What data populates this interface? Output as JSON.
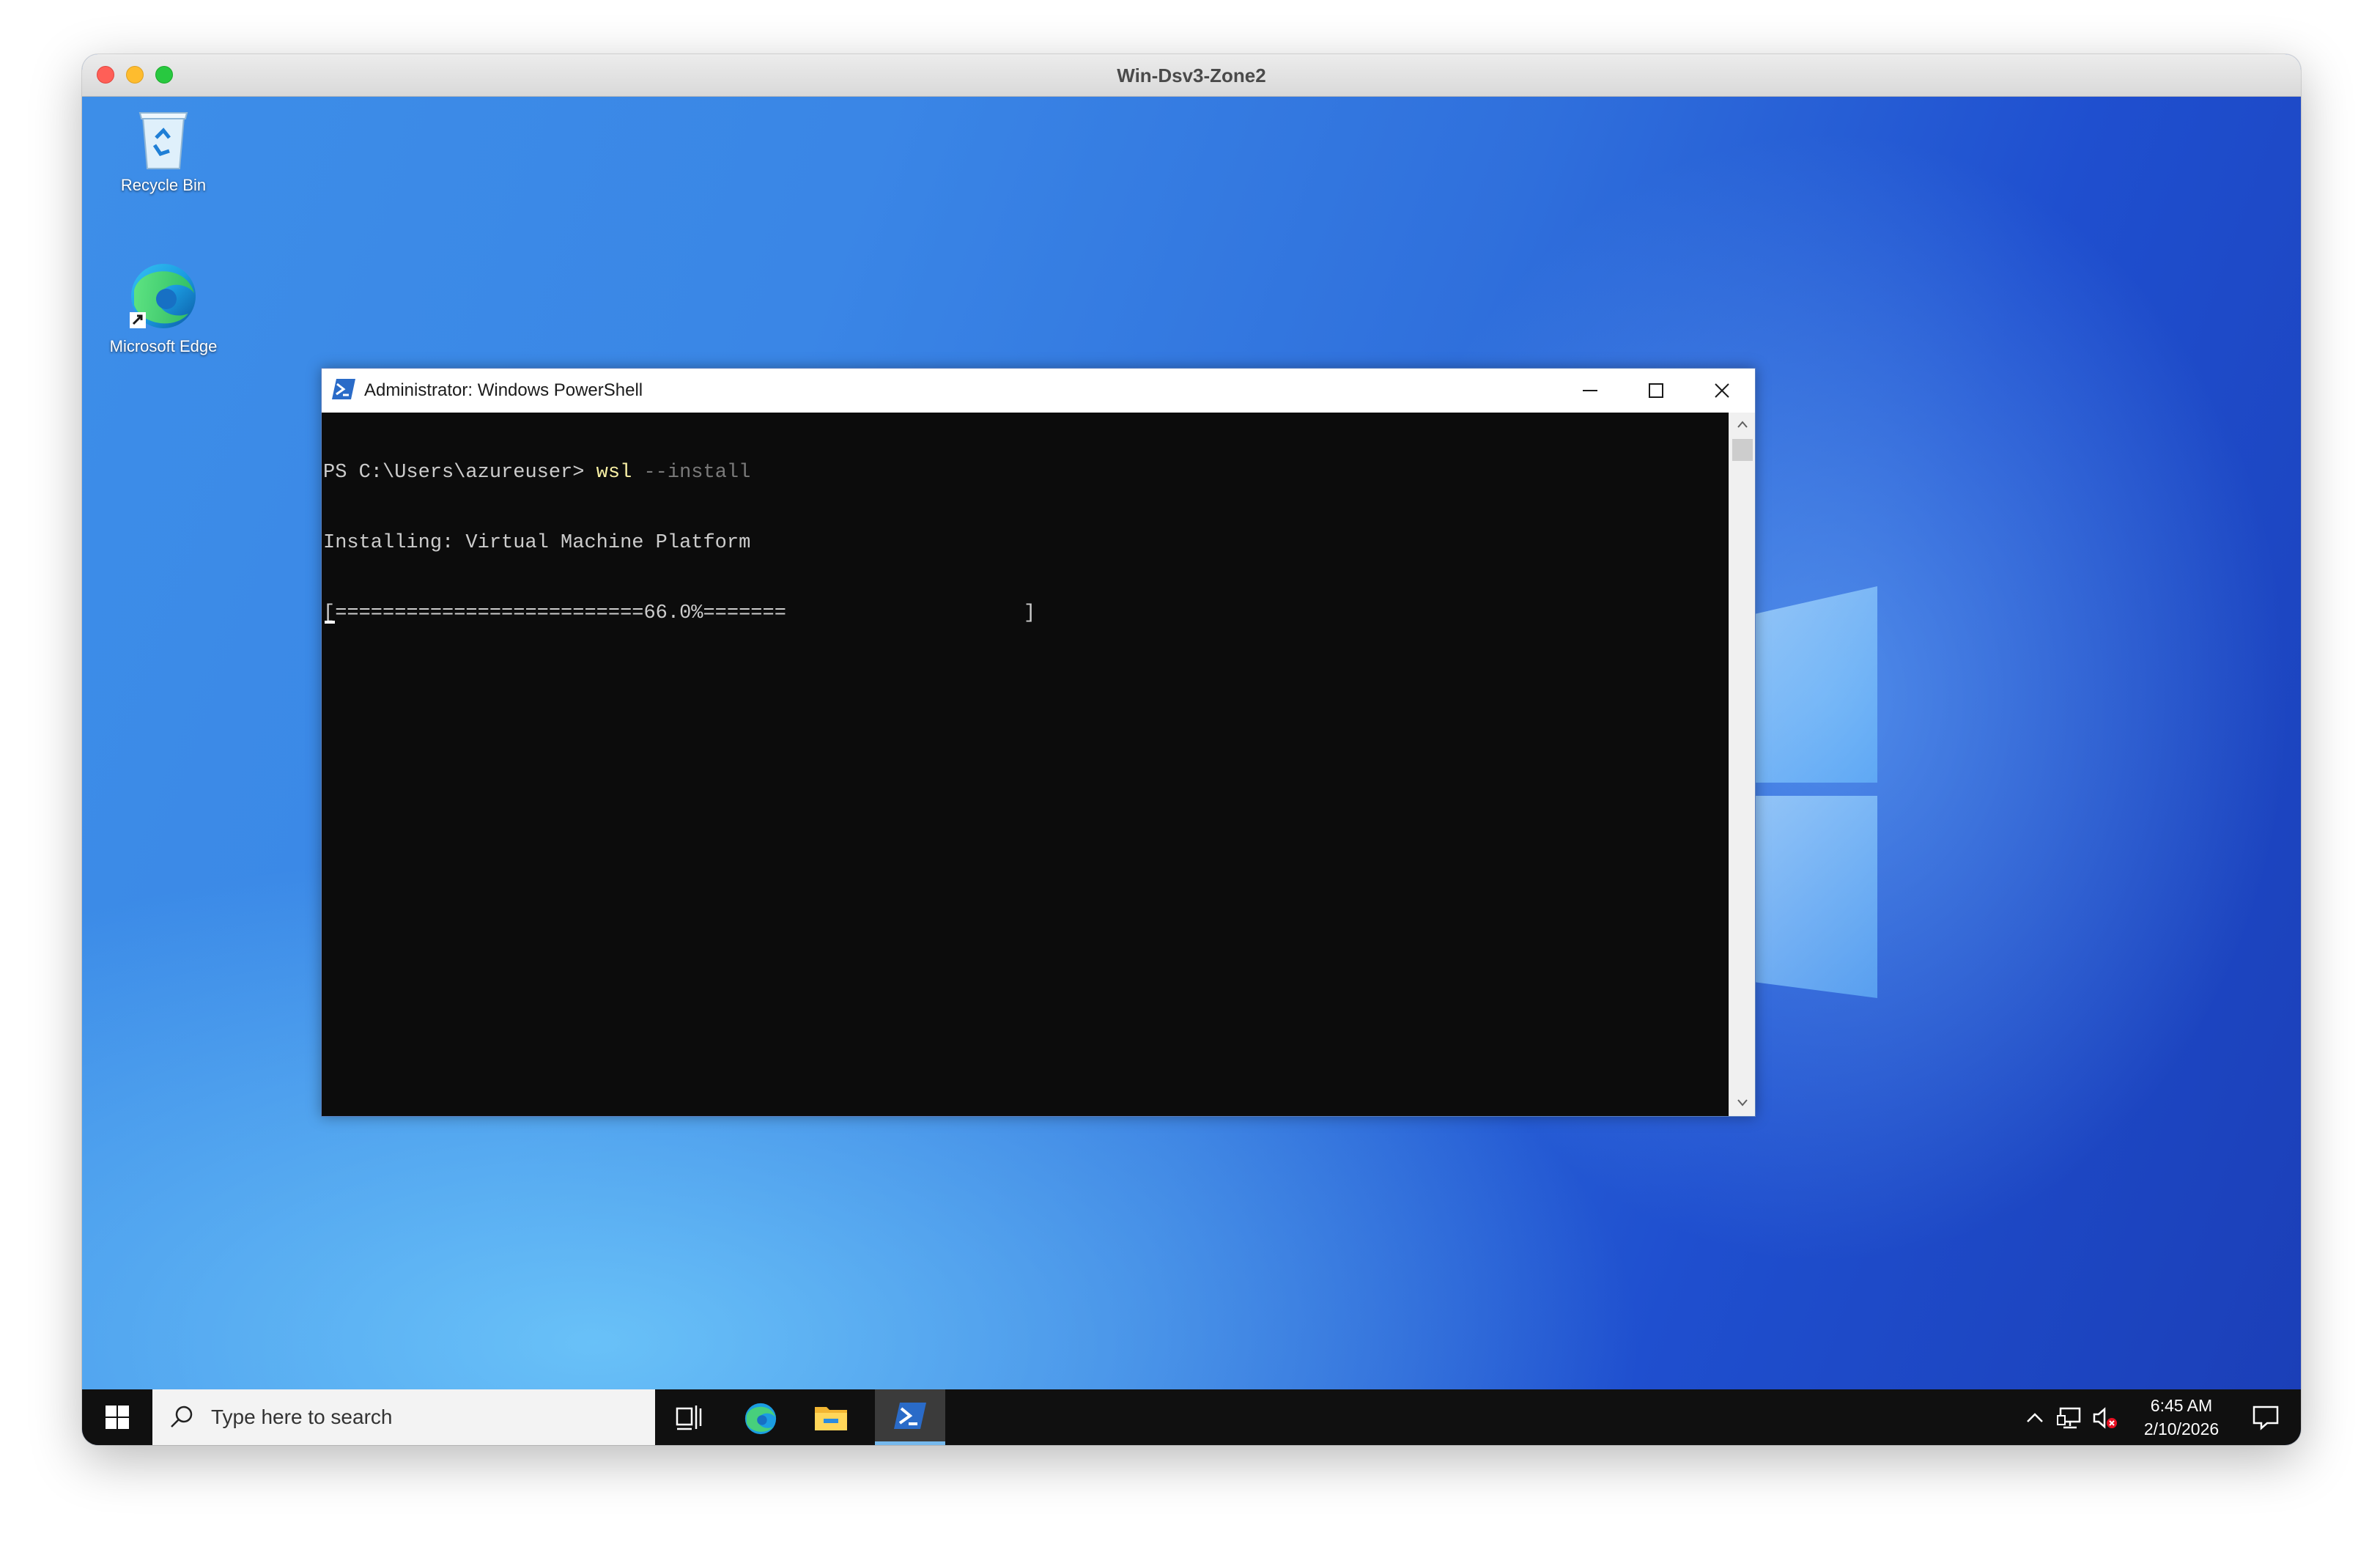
{
  "host_window": {
    "title": "Win-Dsv3-Zone2"
  },
  "desktop": {
    "icons": [
      {
        "label": "Recycle Bin",
        "icon": "recycle-bin-icon"
      },
      {
        "label": "Microsoft Edge",
        "icon": "edge-icon"
      }
    ]
  },
  "powershell_window": {
    "title": "Administrator: Windows PowerShell",
    "console": {
      "prompt": "PS C:\\Users\\azureuser> ",
      "command": "wsl",
      "parameter": " --install",
      "status_line": "Installing: Virtual Machine Platform",
      "progress_line": "[==========================66.0%=======                    ]",
      "progress_percent": 66.0
    }
  },
  "taskbar": {
    "search_placeholder": "Type here to search",
    "apps": [
      "task-view-icon",
      "edge-icon",
      "file-explorer-icon",
      "powershell-icon"
    ],
    "active_app": "powershell-icon",
    "clock": {
      "time": "6:45 AM",
      "date": "2/10/2026"
    }
  },
  "colors": {
    "console_bg": "#0c0c0c",
    "console_text": "#cccccc",
    "command_color": "#f9f1a5",
    "taskbar_bg": "#101010",
    "accent": "#76b9ed"
  }
}
